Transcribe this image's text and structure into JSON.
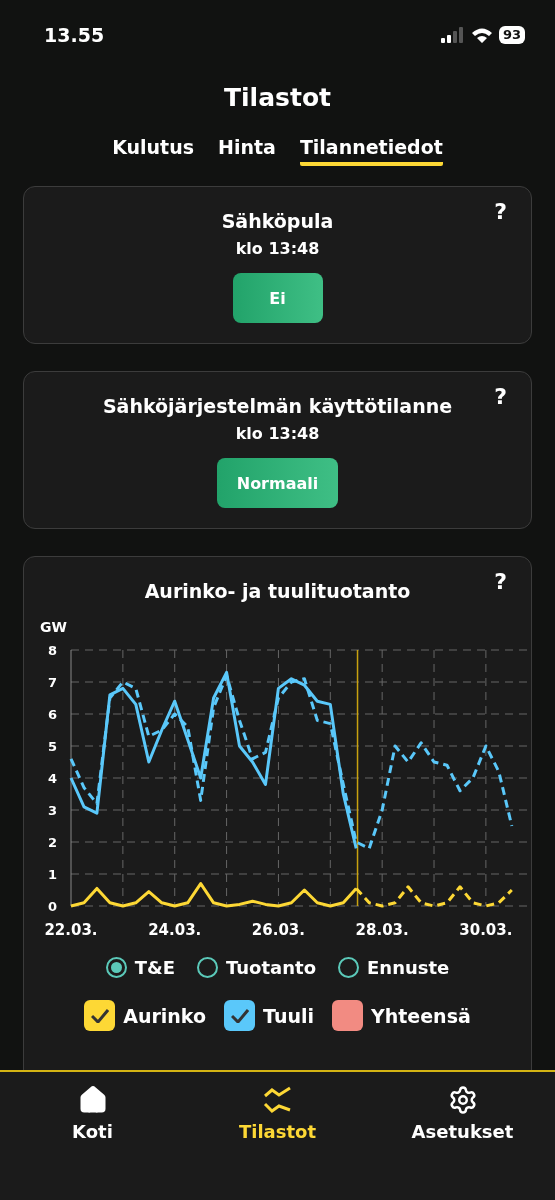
{
  "status_bar": {
    "time": "13.55",
    "battery": "93"
  },
  "header": {
    "title": "Tilastot"
  },
  "tabs": [
    {
      "label": "Kulutus",
      "selected": false
    },
    {
      "label": "Hinta",
      "selected": false
    },
    {
      "label": "Tilannetiedot",
      "selected": true
    }
  ],
  "status_cards": [
    {
      "title": "Sähköpula",
      "time": "klo 13:48",
      "status": "Ei",
      "help": "?"
    },
    {
      "title": "Sähköjärjestelmän käyttötilanne",
      "time": "klo 13:48",
      "status": "Normaali",
      "help": "?"
    }
  ],
  "production_card": {
    "title": "Aurinko- ja tuulituotanto",
    "help": "?",
    "chart_data": {
      "type": "line",
      "ylabel": "GW",
      "categories": [
        "22.03.",
        null,
        null,
        null,
        null,
        null,
        null,
        null,
        "24.03.",
        null,
        null,
        null,
        null,
        null,
        null,
        null,
        "26.03.",
        null,
        null,
        null,
        null,
        null,
        null,
        null,
        "28.03.",
        null,
        null,
        null,
        null,
        null,
        null,
        null,
        "30.03.",
        null,
        null
      ],
      "series": [
        {
          "color": "#5ac8fa",
          "line_style": "solid",
          "values": [
            4.0,
            3.1,
            2.9,
            6.6,
            6.8,
            6.3,
            4.5,
            5.5,
            6.4,
            5.2,
            4.0,
            6.5,
            7.3,
            5.0,
            4.5,
            3.8,
            6.8,
            7.1,
            6.9,
            6.4,
            6.3,
            3.5,
            1.8,
            null,
            null,
            null,
            null,
            null,
            null,
            null,
            null,
            null,
            null,
            null,
            null
          ]
        },
        {
          "color": "#5ac8fa",
          "line_style": "dashed",
          "values": [
            4.6,
            3.7,
            3.2,
            6.5,
            7.0,
            6.8,
            5.3,
            5.5,
            6.0,
            5.6,
            3.3,
            6.2,
            7.2,
            5.8,
            4.6,
            4.8,
            6.5,
            7.0,
            7.1,
            5.8,
            5.7,
            3.8,
            2.0,
            1.8,
            3.0,
            5.0,
            4.5,
            5.1,
            4.5,
            4.4,
            3.6,
            4.0,
            5.0,
            4.2,
            2.5
          ]
        },
        {
          "color": "#fdd835",
          "line_style": "solid",
          "values": [
            0,
            0.1,
            0.55,
            0.1,
            0,
            0.1,
            0.45,
            0.1,
            0,
            0.1,
            0.7,
            0.1,
            0,
            0.05,
            0.15,
            0.05,
            0,
            0.1,
            0.5,
            0.1,
            0,
            0.1,
            0.55,
            null,
            null,
            null,
            null,
            null,
            null,
            null,
            null,
            null,
            null,
            null,
            null
          ]
        },
        {
          "color": "#fdd835",
          "line_style": "dashed",
          "values": [
            null,
            null,
            null,
            null,
            null,
            null,
            null,
            null,
            null,
            null,
            null,
            null,
            null,
            null,
            null,
            null,
            null,
            null,
            null,
            null,
            null,
            null,
            0.55,
            0.1,
            0,
            0.1,
            0.6,
            0.1,
            0,
            0.1,
            0.6,
            0.1,
            0,
            0.1,
            0.5
          ]
        }
      ],
      "ylim": [
        0,
        8
      ],
      "yticks": [
        0,
        1,
        2,
        3,
        4,
        5,
        6,
        7,
        8
      ],
      "grid": true
    },
    "modes": [
      {
        "label": "T&E",
        "selected": true
      },
      {
        "label": "Tuotanto",
        "selected": false
      },
      {
        "label": "Ennuste",
        "selected": false
      }
    ],
    "series_toggles": [
      {
        "label": "Aurinko",
        "checked": true,
        "color": "#fdd835"
      },
      {
        "label": "Tuuli",
        "checked": true,
        "color": "#5ac8fa"
      },
      {
        "label": "Yhteensä",
        "checked": false,
        "color": "#f28b82"
      }
    ]
  },
  "bottom_nav": [
    {
      "label": "Koti",
      "selected": false
    },
    {
      "label": "Tilastot",
      "selected": true
    },
    {
      "label": "Asetukset",
      "selected": false
    }
  ]
}
